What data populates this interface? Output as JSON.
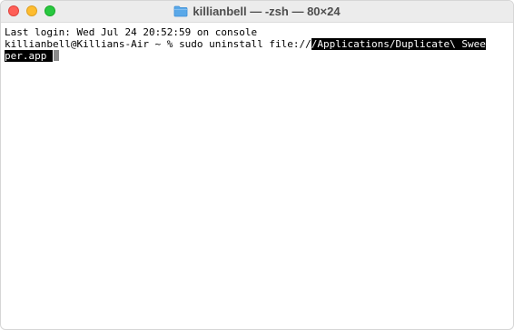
{
  "window": {
    "title": "killianbell — -zsh — 80×24",
    "title_icon": "folder-icon",
    "controls": {
      "close": "close-button",
      "minimize": "minimize-button",
      "zoom": "zoom-button"
    }
  },
  "terminal": {
    "last_login": "Last login: Wed Jul 24 20:52:59 on console",
    "prompt": "killianbell@Killians-Air ~ % ",
    "command_plain": "sudo uninstall file://",
    "command_highlight_1": "/Applications/Duplicate\\ Swee",
    "command_highlight_2": "per.app ",
    "cursor": "block-cursor"
  },
  "colors": {
    "titlebar": "#ececec",
    "close": "#fe5f57",
    "minimize": "#febc2e",
    "zoom": "#28c840",
    "folder": "#5aa8e8",
    "selection_bg": "#000000",
    "selection_fg": "#ffffff"
  }
}
